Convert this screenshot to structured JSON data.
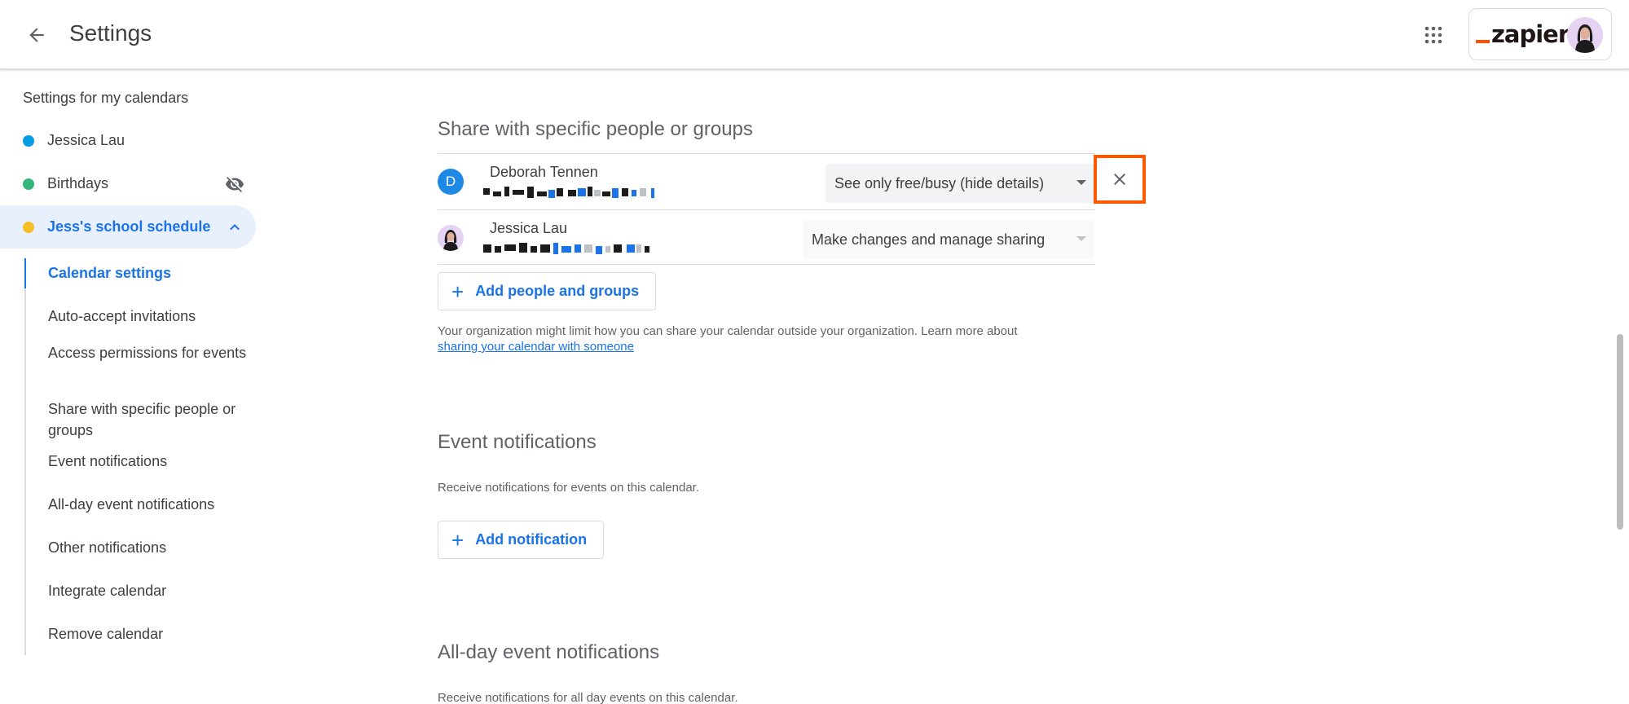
{
  "header": {
    "title": "Settings",
    "account_logo_text": "zapier",
    "back_icon": "arrow-back-icon",
    "apps_icon": "apps-grid-icon"
  },
  "sidebar": {
    "heading": "Settings for my calendars",
    "calendars": [
      {
        "label": "Jessica Lau",
        "color": "#039be5"
      },
      {
        "label": "Birthdays",
        "color": "#33b679",
        "trailing_icon": "visibility-off-icon"
      },
      {
        "label": "Jess's school schedule",
        "color": "#f6bf26",
        "trailing_icon": "chevron-up-icon",
        "active": true
      }
    ],
    "nav": [
      {
        "label": "Calendar settings",
        "active": true
      },
      {
        "label": "Auto-accept invitations"
      },
      {
        "label": "Access permissions for events"
      },
      {
        "label": "Share with specific people or groups"
      },
      {
        "label": "Event notifications"
      },
      {
        "label": "All-day event notifications"
      },
      {
        "label": "Other notifications"
      },
      {
        "label": "Integrate calendar"
      },
      {
        "label": "Remove calendar"
      }
    ]
  },
  "share": {
    "title": "Share with specific people or groups",
    "people": [
      {
        "initial": "D",
        "name": "Deborah Tennen",
        "permission": "See only free/busy (hide details)",
        "avatar_color": "#1e88e5"
      },
      {
        "name": "Jessica Lau",
        "permission": "Make changes and manage sharing"
      }
    ],
    "add_button": "Add people and groups",
    "help_text": "Your organization might limit how you can share your calendar outside your organization. Learn more about",
    "help_link": "sharing your calendar with someone",
    "remove_icon": "close-icon",
    "highlight_color": "#ff5a00"
  },
  "event_notifications": {
    "title": "Event notifications",
    "description": "Receive notifications for events on this calendar.",
    "add_button": "Add notification"
  },
  "allday_notifications": {
    "title": "All-day event notifications",
    "description": "Receive notifications for all day events on this calendar."
  },
  "colors": {
    "accent": "#1a73e8",
    "active_bg": "#e8f0fe"
  }
}
